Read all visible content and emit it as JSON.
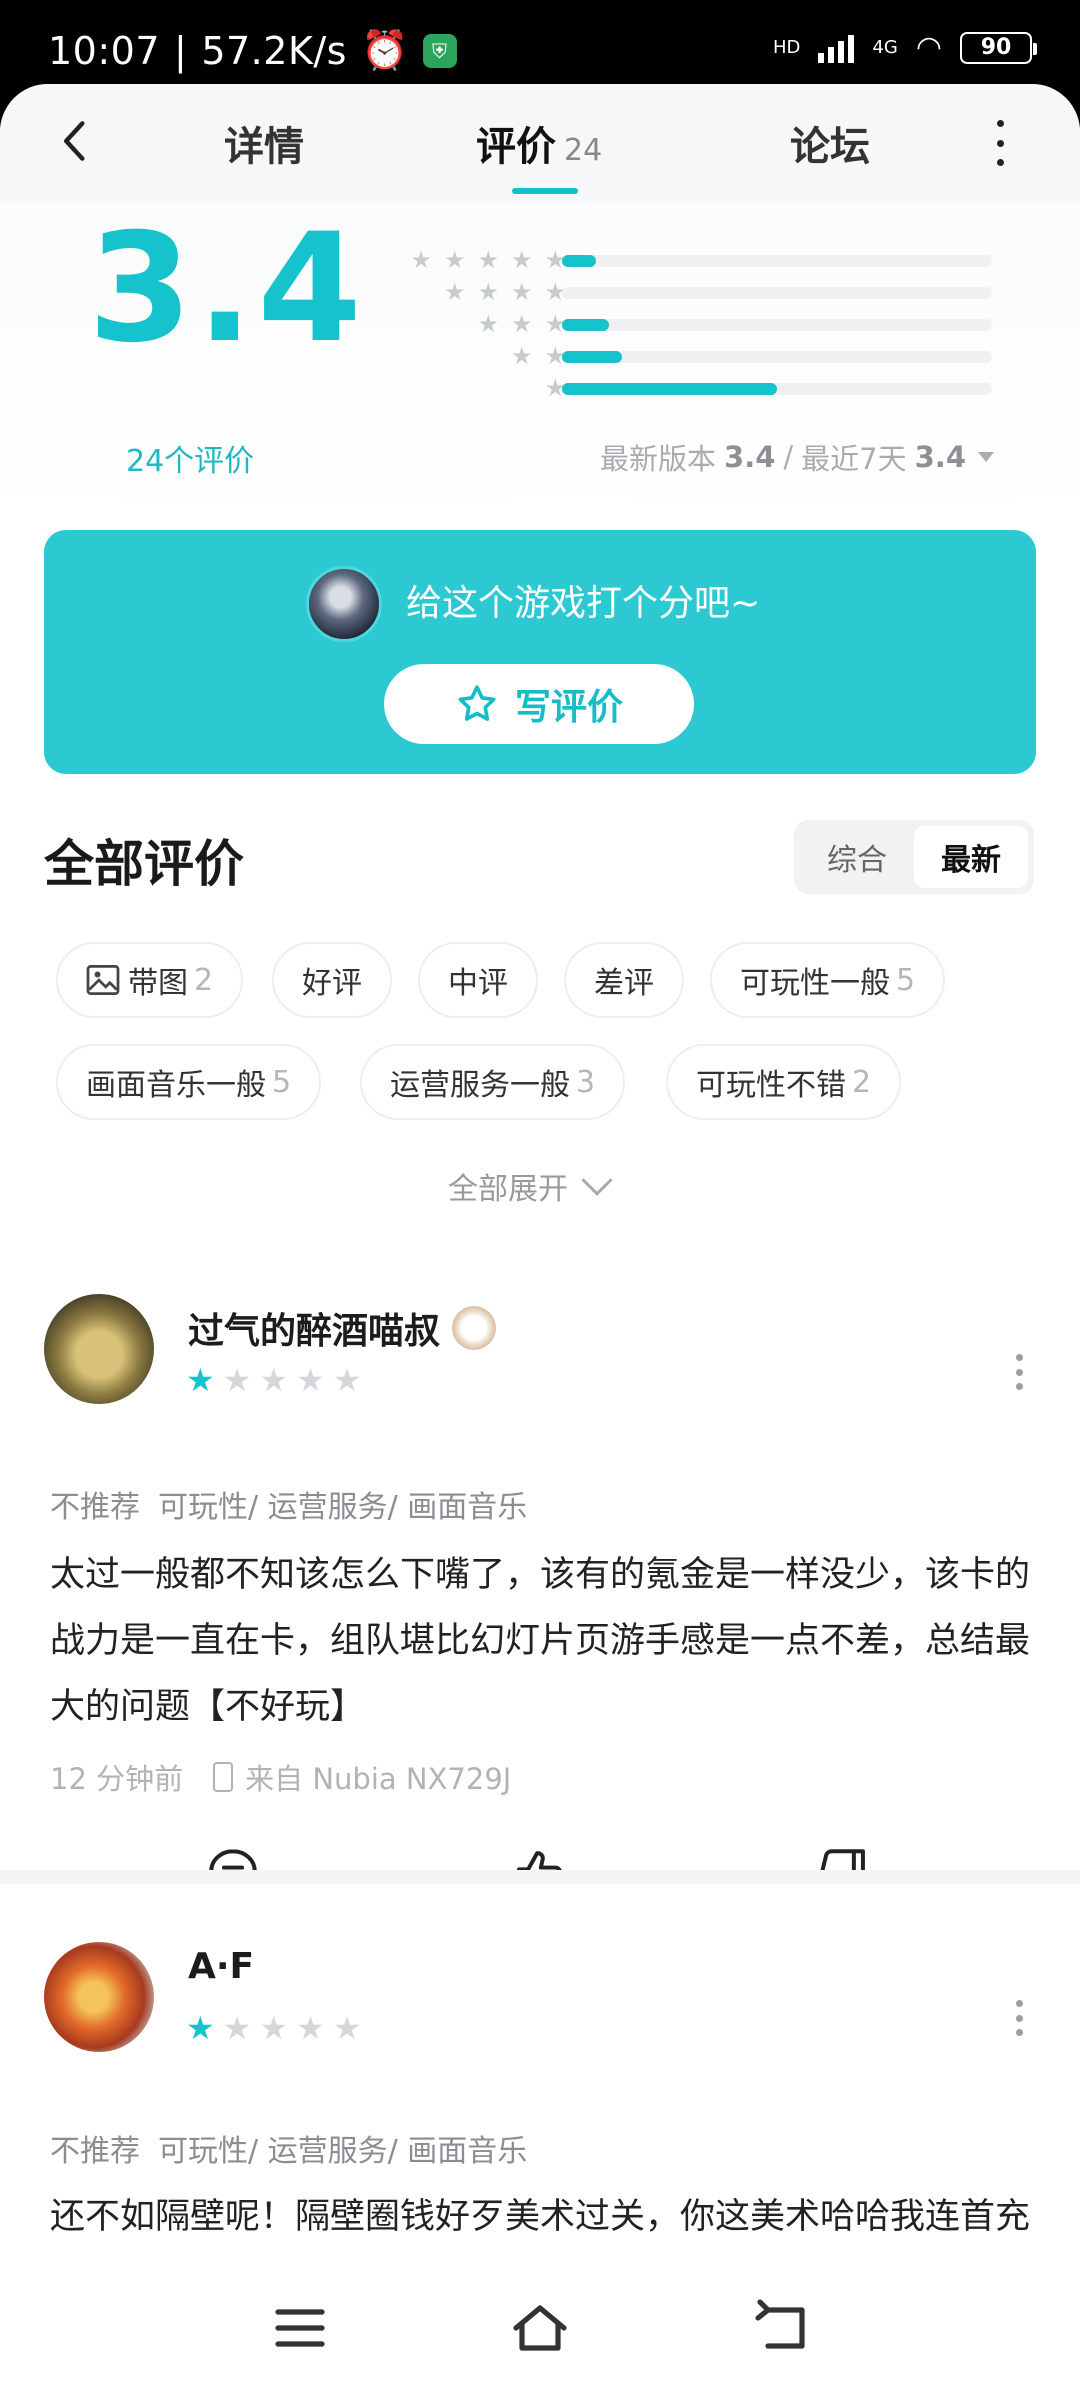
{
  "status_bar": {
    "time": "10:07",
    "speed": "57.2K/s",
    "signal_label": "4G",
    "battery": "90"
  },
  "nav": {
    "tab_detail": "详情",
    "tab_review": "评价",
    "tab_review_count": "24",
    "tab_forum": "论坛"
  },
  "rating": {
    "score": "3.4",
    "count_label": "24个评价",
    "version_label": "最新版本",
    "version_score": "3.4",
    "recent_label": "最近7天",
    "recent_score": "3.4",
    "separator": "/",
    "distribution": [
      {
        "stars": 5,
        "fraction": 0.08
      },
      {
        "stars": 4,
        "fraction": 0.0
      },
      {
        "stars": 3,
        "fraction": 0.11
      },
      {
        "stars": 2,
        "fraction": 0.14
      },
      {
        "stars": 1,
        "fraction": 0.5
      }
    ]
  },
  "rate_card": {
    "prompt": "给这个游戏打个分吧~",
    "button": "写评价"
  },
  "reviews_section": {
    "title": "全部评价",
    "sort_options": [
      "综合",
      "最新"
    ],
    "active_sort": "最新",
    "chips": [
      {
        "label": "带图",
        "count": "2",
        "icon": "image-icon"
      },
      {
        "label": "好评",
        "count": ""
      },
      {
        "label": "中评",
        "count": ""
      },
      {
        "label": "差评",
        "count": ""
      },
      {
        "label": "可玩性一般",
        "count": "5"
      },
      {
        "label": "画面音乐一般",
        "count": "5"
      },
      {
        "label": "运营服务一般",
        "count": "3"
      },
      {
        "label": "可玩性不错",
        "count": "2"
      }
    ],
    "expand": "全部展开"
  },
  "reviews": [
    {
      "user": "过气的醉酒喵叔",
      "rating": 1,
      "recommend": "不推荐",
      "tags": "可玩性/ 运营服务/ 画面音乐",
      "text": "太过一般都不知该怎么下嘴了，该有的氪金是一样没少，该卡的战力是一直在卡，组队堪比幻灯片页游手感是一点不差，总结最大的问题【不好玩】",
      "time": "12 分钟前",
      "device": "来自 Nubia NX729J"
    },
    {
      "user": "A·F",
      "rating": 1,
      "recommend": "不推荐",
      "tags": "可玩性/ 运营服务/ 画面音乐",
      "text": "还不如隔壁呢！隔壁圈钱好歹美术过关，你这美术哈哈我连首充都懒得充！！"
    }
  ],
  "colors": {
    "accent": "#16c2cc",
    "card": "#2cc9d2"
  }
}
